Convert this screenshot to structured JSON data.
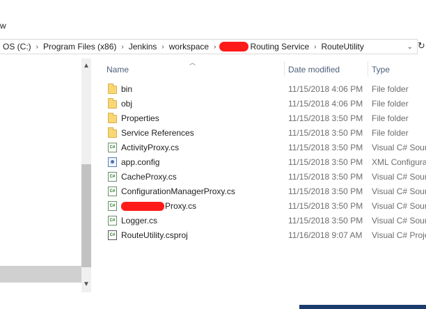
{
  "ribbon": {
    "label": "w"
  },
  "address": {
    "crumbs": [
      "OS (C:)",
      "Program Files (x86)",
      "Jenkins",
      "workspace",
      "Routing Service",
      "RouteUtility"
    ]
  },
  "columns": {
    "name": "Name",
    "date": "Date modified",
    "type": "Type"
  },
  "files": [
    {
      "name": "bin",
      "date": "11/15/2018 4:06 PM",
      "type": "File folder",
      "icon": "folder-icon"
    },
    {
      "name": "obj",
      "date": "11/15/2018 4:06 PM",
      "type": "File folder",
      "icon": "folder-icon"
    },
    {
      "name": "Properties",
      "date": "11/15/2018 3:50 PM",
      "type": "File folder",
      "icon": "folder-icon"
    },
    {
      "name": "Service References",
      "date": "11/15/2018 3:50 PM",
      "type": "File folder",
      "icon": "folder-icon"
    },
    {
      "name": "ActivityProxy.cs",
      "date": "11/15/2018 3:50 PM",
      "type": "Visual C# Sourc",
      "icon": "csharp-file-icon"
    },
    {
      "name": "app.config",
      "date": "11/15/2018 3:50 PM",
      "type": "XML Configura",
      "icon": "config-file-icon"
    },
    {
      "name": "CacheProxy.cs",
      "date": "11/15/2018 3:50 PM",
      "type": "Visual C# Sourc",
      "icon": "csharp-file-icon"
    },
    {
      "name": "ConfigurationManagerProxy.cs",
      "date": "11/15/2018 3:50 PM",
      "type": "Visual C# Sourc",
      "icon": "csharp-file-icon"
    },
    {
      "name": "Proxy.cs",
      "date": "11/15/2018 3:50 PM",
      "type": "Visual C# Sourc",
      "icon": "csharp-file-icon"
    },
    {
      "name": "Logger.cs",
      "date": "11/15/2018 3:50 PM",
      "type": "Visual C# Sourc",
      "icon": "csharp-file-icon"
    },
    {
      "name": "RouteUtility.csproj",
      "date": "11/16/2018 9:07 AM",
      "type": "Visual C# Proje",
      "icon": "csproj-file-icon"
    }
  ],
  "colors": {
    "redaction": "#ff1a1a",
    "header_text": "#4c607a"
  }
}
